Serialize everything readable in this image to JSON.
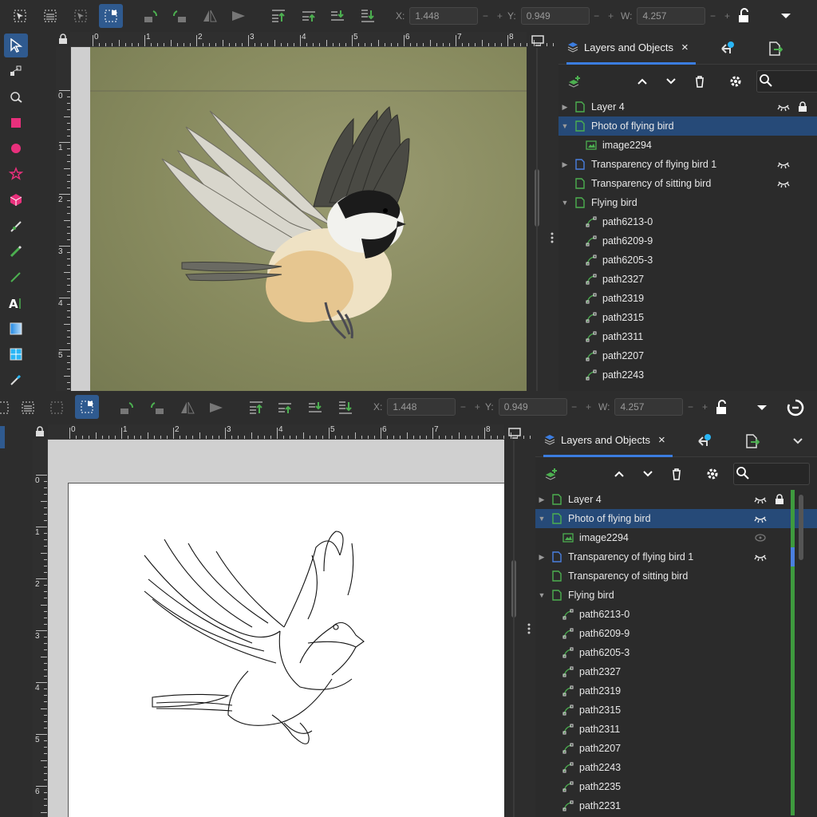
{
  "toolbar": {
    "x_label": "X:",
    "x_value": "1.448",
    "y_label": "Y:",
    "y_value": "0.949",
    "w_label": "W:",
    "w_value": "4.257",
    "plus": "+",
    "minus": "−"
  },
  "ruler_top": [
    "0",
    "1",
    "2",
    "3",
    "4",
    "5",
    "6",
    "7",
    "8"
  ],
  "ruler_left_top": [
    "0",
    "1",
    "2",
    "3",
    "4",
    "5"
  ],
  "ruler_left_bottom": [
    "0",
    "1",
    "2",
    "3",
    "4",
    "5",
    "6"
  ],
  "panel": {
    "tab_label": "Layers and Objects",
    "close": "×",
    "search_placeholder": ""
  },
  "tree_top": [
    {
      "label": "Layer 4",
      "depth": 0,
      "kind": "layer",
      "twisty": "collapsed",
      "eye": true,
      "lock": true
    },
    {
      "label": "Photo of flying bird",
      "depth": 0,
      "kind": "layer",
      "twisty": "expanded",
      "selected": true
    },
    {
      "label": "image2294",
      "depth": 1,
      "kind": "image"
    },
    {
      "label": "Transparency of flying bird 1",
      "depth": 0,
      "kind": "layer-blue",
      "twisty": "collapsed",
      "eye": true
    },
    {
      "label": "Transparency of sitting bird",
      "depth": 0,
      "kind": "layer",
      "eye": true
    },
    {
      "label": "Flying bird",
      "depth": 0,
      "kind": "layer",
      "twisty": "expanded"
    },
    {
      "label": "path6213-0",
      "depth": 1,
      "kind": "path"
    },
    {
      "label": "path6209-9",
      "depth": 1,
      "kind": "path"
    },
    {
      "label": "path6205-3",
      "depth": 1,
      "kind": "path"
    },
    {
      "label": "path2327",
      "depth": 1,
      "kind": "path"
    },
    {
      "label": "path2319",
      "depth": 1,
      "kind": "path"
    },
    {
      "label": "path2315",
      "depth": 1,
      "kind": "path"
    },
    {
      "label": "path2311",
      "depth": 1,
      "kind": "path"
    },
    {
      "label": "path2207",
      "depth": 1,
      "kind": "path"
    },
    {
      "label": "path2243",
      "depth": 1,
      "kind": "path"
    }
  ],
  "tree_bottom": [
    {
      "label": "Layer 4",
      "depth": 0,
      "kind": "layer",
      "twisty": "collapsed",
      "eye": true,
      "lock": true,
      "bar": "green"
    },
    {
      "label": "Photo of flying bird",
      "depth": 0,
      "kind": "layer",
      "twisty": "expanded",
      "selected": true,
      "eye": true,
      "bar": "green"
    },
    {
      "label": "image2294",
      "depth": 1,
      "kind": "image",
      "eye_dim": true,
      "bar": "green"
    },
    {
      "label": "Transparency of flying bird 1",
      "depth": 0,
      "kind": "layer-blue",
      "twisty": "collapsed",
      "eye": true,
      "bar": "blue"
    },
    {
      "label": "Transparency of sitting bird",
      "depth": 0,
      "kind": "layer",
      "bar": "green"
    },
    {
      "label": "Flying bird",
      "depth": 0,
      "kind": "layer",
      "twisty": "expanded",
      "bar": "green"
    },
    {
      "label": "path6213-0",
      "depth": 1,
      "kind": "path",
      "bar": "green"
    },
    {
      "label": "path6209-9",
      "depth": 1,
      "kind": "path",
      "bar": "green"
    },
    {
      "label": "path6205-3",
      "depth": 1,
      "kind": "path",
      "bar": "green"
    },
    {
      "label": "path2327",
      "depth": 1,
      "kind": "path",
      "bar": "green"
    },
    {
      "label": "path2319",
      "depth": 1,
      "kind": "path",
      "bar": "green"
    },
    {
      "label": "path2315",
      "depth": 1,
      "kind": "path",
      "bar": "green"
    },
    {
      "label": "path2311",
      "depth": 1,
      "kind": "path",
      "bar": "green"
    },
    {
      "label": "path2207",
      "depth": 1,
      "kind": "path",
      "bar": "green"
    },
    {
      "label": "path2243",
      "depth": 1,
      "kind": "path",
      "bar": "green"
    },
    {
      "label": "path2235",
      "depth": 1,
      "kind": "path",
      "bar": "green"
    },
    {
      "label": "path2231",
      "depth": 1,
      "kind": "path",
      "bar": "green"
    }
  ],
  "colors": {
    "accent": "#3b7de0",
    "selection": "#264a78",
    "layer_icon": "#4caf50",
    "layer_blue": "#4a7fe0",
    "photo_bg": "#8a8d62"
  }
}
